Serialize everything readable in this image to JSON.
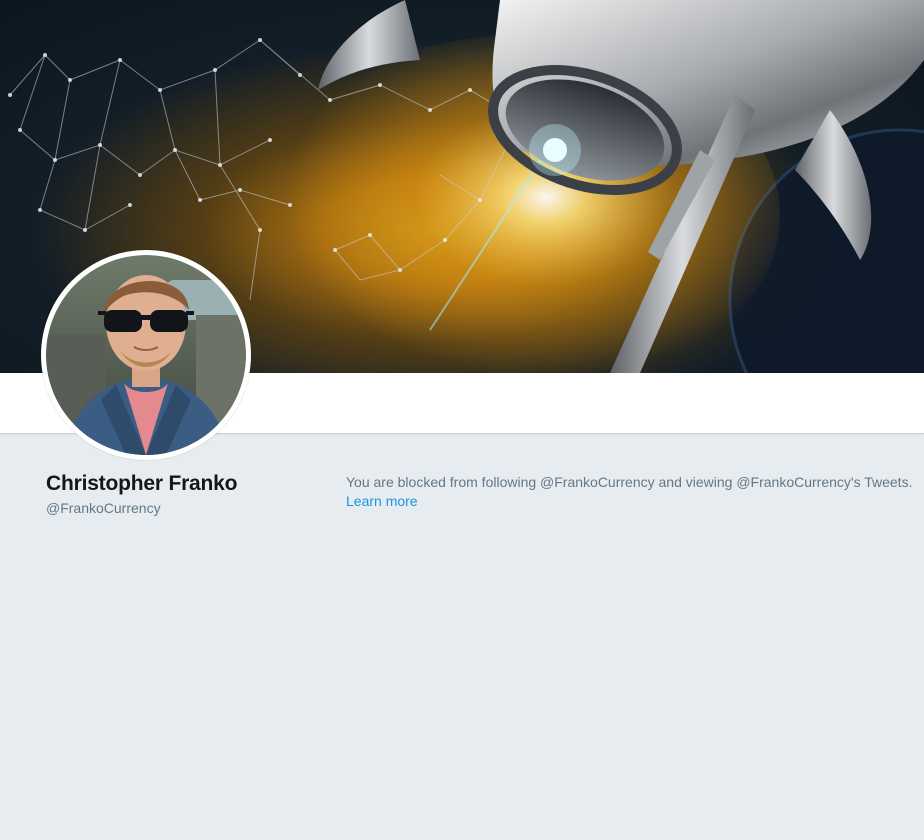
{
  "profile": {
    "name": "Christopher Franko",
    "screen_name": "@FrankoCurrency"
  },
  "blocked_notice": {
    "message": "You are blocked from following @FrankoCurrency and viewing @FrankoCurrency's Tweets.",
    "learn_more": "Learn more"
  },
  "colors": {
    "page_background": "#e6ecf0",
    "link": "#1b95e0",
    "name": "#14171a",
    "muted": "#657786"
  },
  "icons": {
    "banner": "rocket-space-banner",
    "avatar": "profile-photo"
  }
}
